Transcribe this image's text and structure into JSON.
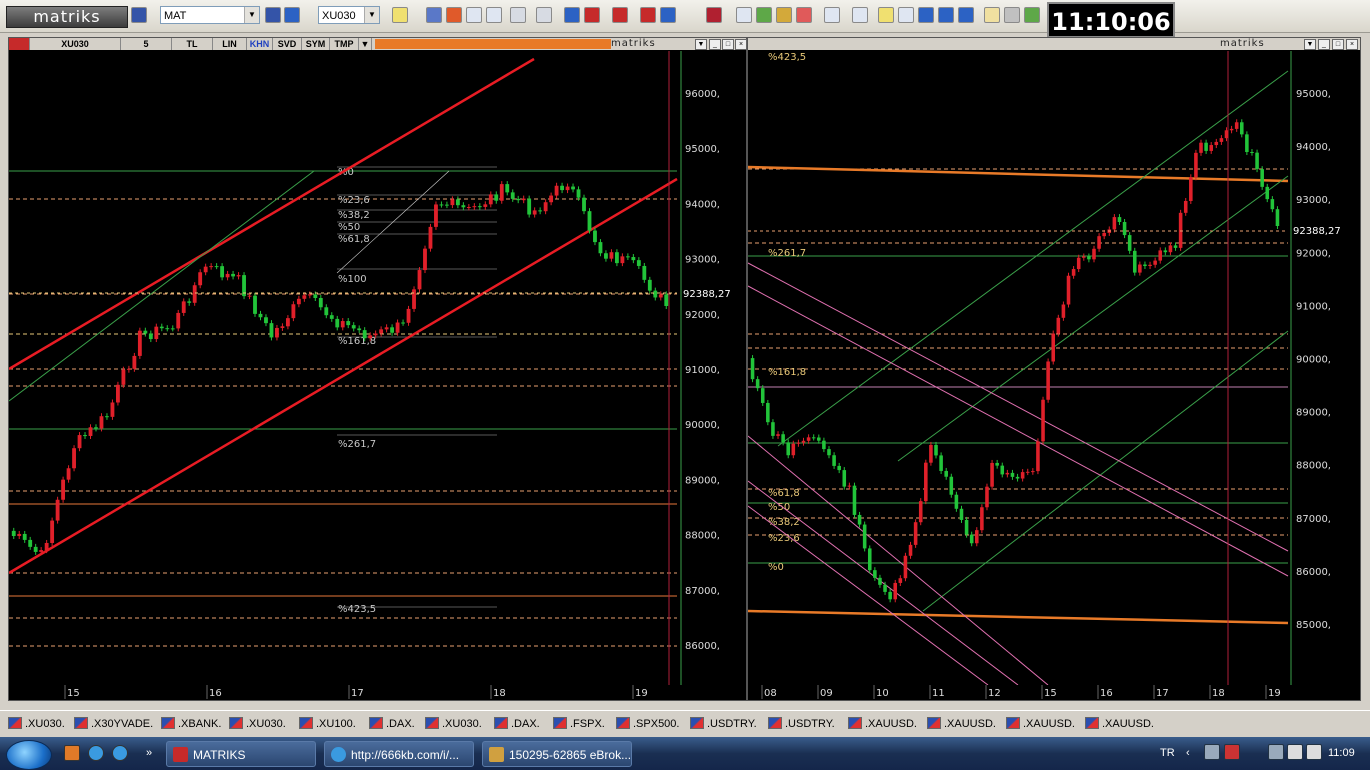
{
  "app": {
    "logo_text": "matriks",
    "clock": "11:10:06"
  },
  "toolbar": {
    "layout_select": "MAT",
    "symbol_select": "XU030"
  },
  "left_panel": {
    "symbol": "XU030",
    "period": "5",
    "buttons": [
      "TL",
      "LIN",
      "KHN",
      "SVD",
      "SYM",
      "TMP"
    ],
    "brand": "matriks",
    "price_labels": [
      "96000,",
      "95000,",
      "94000,",
      "93000,",
      "92000,",
      "91000,",
      "90000,",
      "89000,",
      "88000,",
      "87000,",
      "86000,"
    ],
    "last_price": "92388,27",
    "fib_labels": [
      "%0",
      "%23,6",
      "%38,2",
      "%50",
      "%61,8",
      "%100",
      "%161,8",
      "%261,7",
      "%423,5"
    ],
    "x_labels": [
      "15",
      "16",
      "17",
      "18",
      "19"
    ]
  },
  "right_panel": {
    "brand": "matriks",
    "price_labels": [
      "95000,",
      "94000,",
      "93000,",
      "92000,",
      "91000,",
      "90000,",
      "89000,",
      "88000,",
      "87000,",
      "86000,",
      "85000,"
    ],
    "last_price": "92388,27",
    "fib_labels": [
      "%423,5",
      "%261,7",
      "%161,8",
      "%61,8",
      "%50",
      "%38,2",
      "%23,6",
      "%0"
    ],
    "x_labels": [
      "08",
      "09",
      "10",
      "11",
      "12",
      "15",
      "16",
      "17",
      "18",
      "19"
    ]
  },
  "symbol_tabs": [
    ".XU030.",
    ".X30YVADE.",
    ".XBANK.",
    ".XU030.",
    ".XU100.",
    ".DAX.",
    ".XU030.",
    ".DAX.",
    ".FSPX.",
    ".SPX500.",
    ".USDTRY.",
    ".USDTRY.",
    ".XAUUSD.",
    ".XAUUSD.",
    ".XAUUSD.",
    ".XAUUSD."
  ],
  "taskbar": {
    "items": [
      "MATRIKS",
      "http://666kb.com/i/...",
      "150295-62865 eBrok..."
    ],
    "lang": "TR",
    "time": "11:09"
  },
  "colors": {
    "chart_bg": "#000000",
    "up_candle": "#22c43a",
    "down_candle": "#e0202a",
    "channel": "#e81c24",
    "fib": "#e8c878",
    "accent": "#e87a28"
  }
}
